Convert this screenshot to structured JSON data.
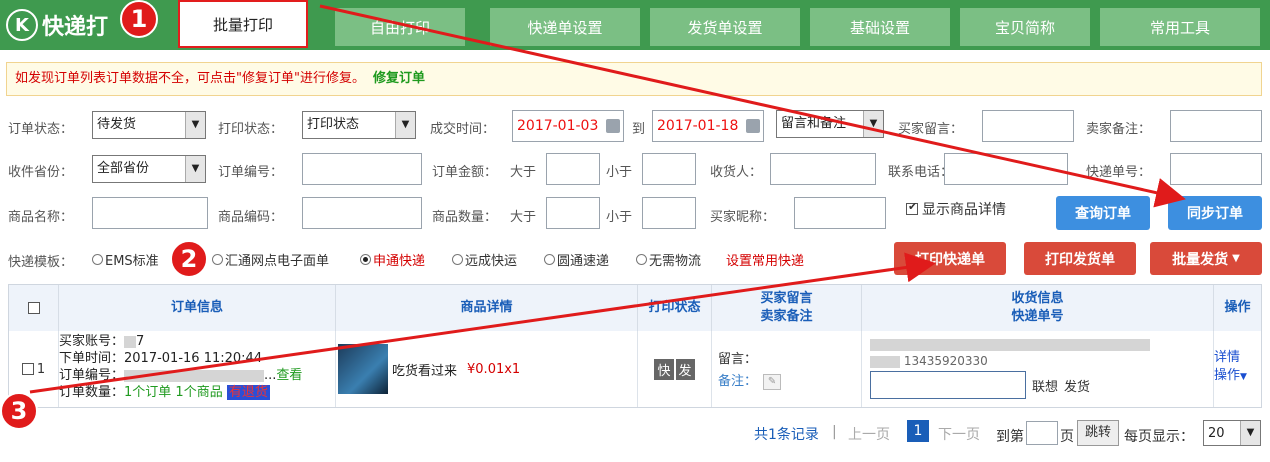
{
  "app": {
    "logo_letter": "K",
    "logo_text": "快递打"
  },
  "tabs": [
    {
      "label": "批量打印"
    },
    {
      "label": "自由打印"
    },
    {
      "label": "快递单设置"
    },
    {
      "label": "发货单设置"
    },
    {
      "label": "基础设置"
    },
    {
      "label": "宝贝简称"
    },
    {
      "label": "常用工具"
    }
  ],
  "notice": {
    "text": "如发现订单列表订单数据不全，可点击\"修复订单\"进行修复。",
    "link": "修复订单"
  },
  "filters": {
    "order_status_label": "订单状态：",
    "order_status_value": "待发货",
    "print_status_label": "打印状态：",
    "print_status_value": "打印状态",
    "deal_time_label": "成交时间：",
    "date_from": "2017-01-03",
    "date_to_label": "到",
    "date_to": "2017-01-18",
    "remark_select": "留言和备注",
    "buyer_msg_label": "买家留言：",
    "seller_note_label": "卖家备注：",
    "province_label": "收件省份：",
    "province_value": "全部省份",
    "order_no_label": "订单编号：",
    "amount_label": "订单金额：",
    "greater_label": "大于",
    "less_label": "小于",
    "receiver_label": "收货人：",
    "phone_label": "联系电话：",
    "express_no_label": "快递单号：",
    "goods_name_label": "商品名称：",
    "goods_code_label": "商品编码：",
    "qty_label": "商品数量：",
    "qty_greater": "大于",
    "qty_less": "小于",
    "buyer_nick_label": "买家昵称：",
    "show_detail_label": "显示商品详情",
    "query_button": "查询订单",
    "sync_button": "同步订单"
  },
  "express": {
    "label": "快递模板：",
    "options": [
      "EMS标准",
      "汇通网点电子面单",
      "申通快递",
      "远成快运",
      "圆通速递",
      "无需物流"
    ],
    "selected": "申通快递",
    "set_common": "设置常用快递",
    "print_express": "打印快递单",
    "print_invoice": "打印发货单",
    "batch_ship": "批量发货"
  },
  "table": {
    "headers": {
      "order": "订单信息",
      "goods": "商品详情",
      "print": "打印状态",
      "msg": "买家留言",
      "note": "卖家备注",
      "recv": "收货信息",
      "recv2": "快递单号",
      "op": "操作"
    },
    "row": {
      "index": "1",
      "buyer_label": "买家账号：",
      "buyer_tail": "7",
      "time_label": "下单时间：",
      "time_value": "2017-01-16 11:20:44",
      "no_label": "订单编号：",
      "no_tail": "...",
      "view": "查看",
      "count_label": "订单数量：",
      "count_value": "1个订单 1个商品",
      "urge": "有退货",
      "goods_title": "吃货看过来",
      "price": "¥0.01x1",
      "print_a": "快",
      "print_b": "发",
      "msg_label": "留言：",
      "note_label": "备注：",
      "recv_phone_tail": "13435920330",
      "contact": "联想",
      "ship": "发货",
      "detail": "详情",
      "op": "操作"
    }
  },
  "pager": {
    "total": "共1条记录",
    "prev": "上一页",
    "page": "1",
    "next": "下一页",
    "goto_label": "到第",
    "page_unit": "页",
    "jump": "跳转",
    "per_page_label": "每页显示：",
    "per_page": "20"
  },
  "annotations": [
    "1",
    "2",
    "3"
  ],
  "colors": {
    "header_green": "#3f9a4f",
    "tab_green": "#7bbf84",
    "blue_btn": "#3d8fe0",
    "red_btn": "#d94a3a",
    "annotation_red": "#e01b1b"
  }
}
